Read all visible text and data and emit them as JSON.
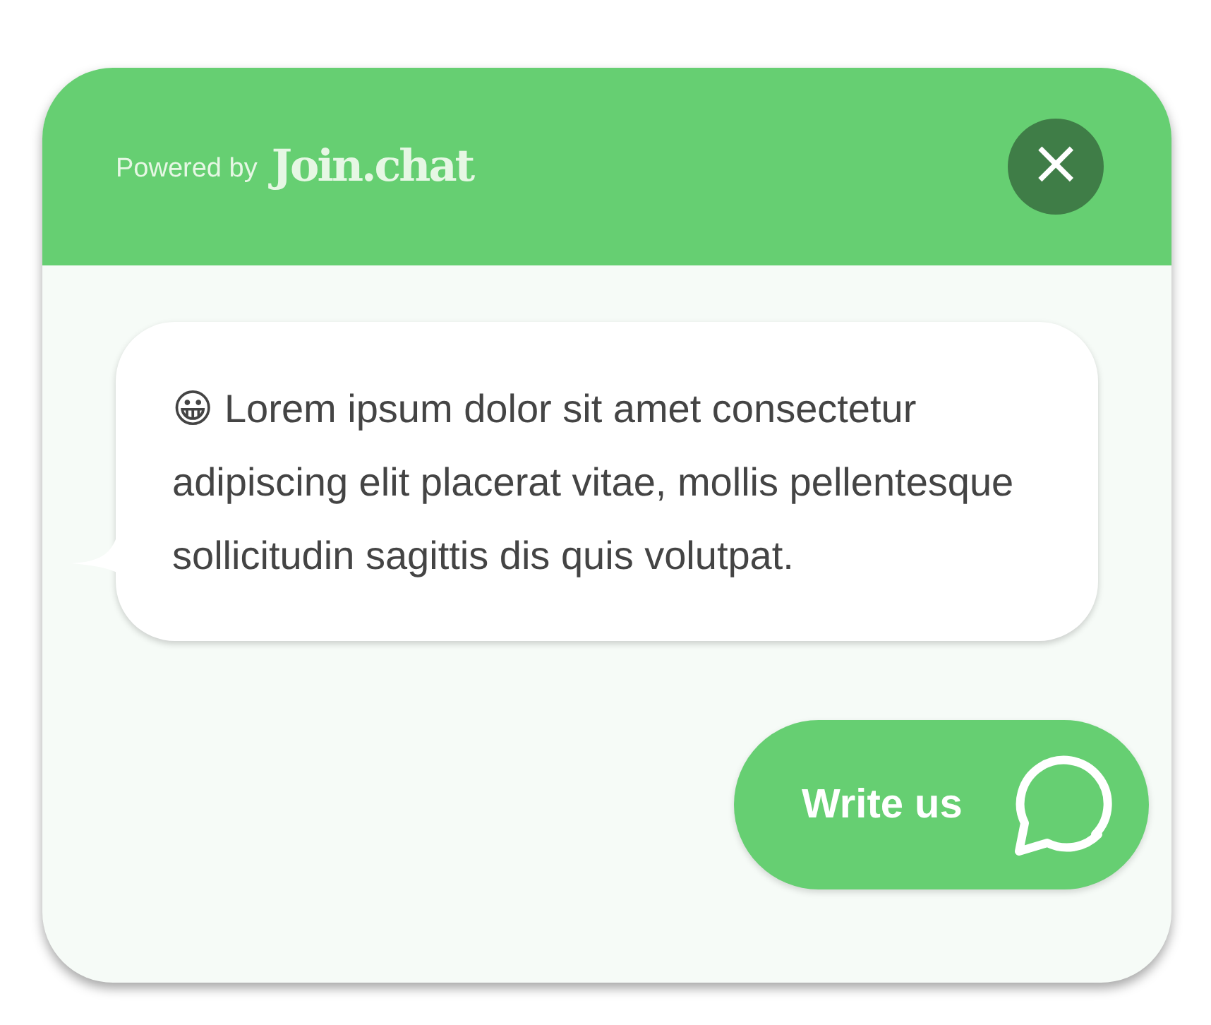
{
  "header": {
    "powered_by": "Powered by",
    "brand": "Join.chat",
    "close_button": "×"
  },
  "message": {
    "text": "😀 Lorem ipsum dolor sit amet consectetur adipiscing elit placerat vitae, mollis pellentesque sollicitudin sagittis dis quis volutpat."
  },
  "cta_button": {
    "label": "Write us"
  }
}
